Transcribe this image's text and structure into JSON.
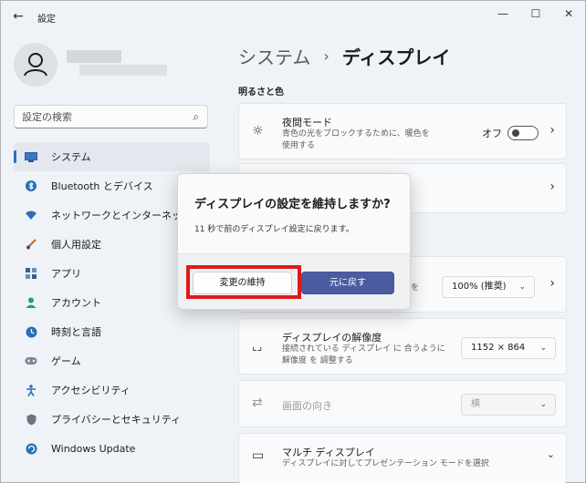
{
  "window": {
    "app_title": "設定",
    "back_glyph": "←",
    "controls": {
      "minimize": "—",
      "maximize": "☐",
      "close": "✕"
    }
  },
  "search": {
    "placeholder": "設定の検索"
  },
  "nav": {
    "items": [
      {
        "label": "システム",
        "icon": "monitor-icon",
        "active": true
      },
      {
        "label": "Bluetooth とデバイス",
        "icon": "bluetooth-icon"
      },
      {
        "label": "ネットワークとインターネット",
        "icon": "wifi-icon"
      },
      {
        "label": "個人用設定",
        "icon": "brush-icon"
      },
      {
        "label": "アプリ",
        "icon": "apps-icon"
      },
      {
        "label": "アカウント",
        "icon": "person-icon"
      },
      {
        "label": "時刻と言語",
        "icon": "globe-clock-icon"
      },
      {
        "label": "ゲーム",
        "icon": "gamepad-icon"
      },
      {
        "label": "アクセシビリティ",
        "icon": "accessibility-icon"
      },
      {
        "label": "プライバシーとセキュリティ",
        "icon": "shield-icon"
      },
      {
        "label": "Windows Update",
        "icon": "update-icon"
      }
    ]
  },
  "main": {
    "breadcrumb": {
      "parent": "システム",
      "separator": "›",
      "current": "ディスプレイ"
    },
    "section_title": "明るさと色",
    "night_light": {
      "title": "夜間モード",
      "desc": "青色の光をブロックするために、暖色を使用する",
      "toggle_label": "オフ"
    },
    "scale": {
      "desc_tail": "を",
      "value": "100% (推奨)"
    },
    "resolution": {
      "title": "ディスプレイの解像度",
      "desc": "接続されている ディスプレイ に 合うように 解像度 を 調整する",
      "value": "1152 × 864"
    },
    "orientation": {
      "title": "画面の向き",
      "value": "横"
    },
    "multi_display": {
      "title": "マルチ ディスプレイ",
      "desc": "ディスプレイに対してプレゼンテーション モードを選択"
    }
  },
  "dialog": {
    "title": "ディスプレイの設定を維持しますか?",
    "message": "11 秒で前のディスプレイ設定に戻ります。",
    "keep_label": "変更の維持",
    "revert_label": "元に戻す"
  },
  "colors": {
    "accent": "#4b5ca0",
    "highlight": "#e01818"
  }
}
